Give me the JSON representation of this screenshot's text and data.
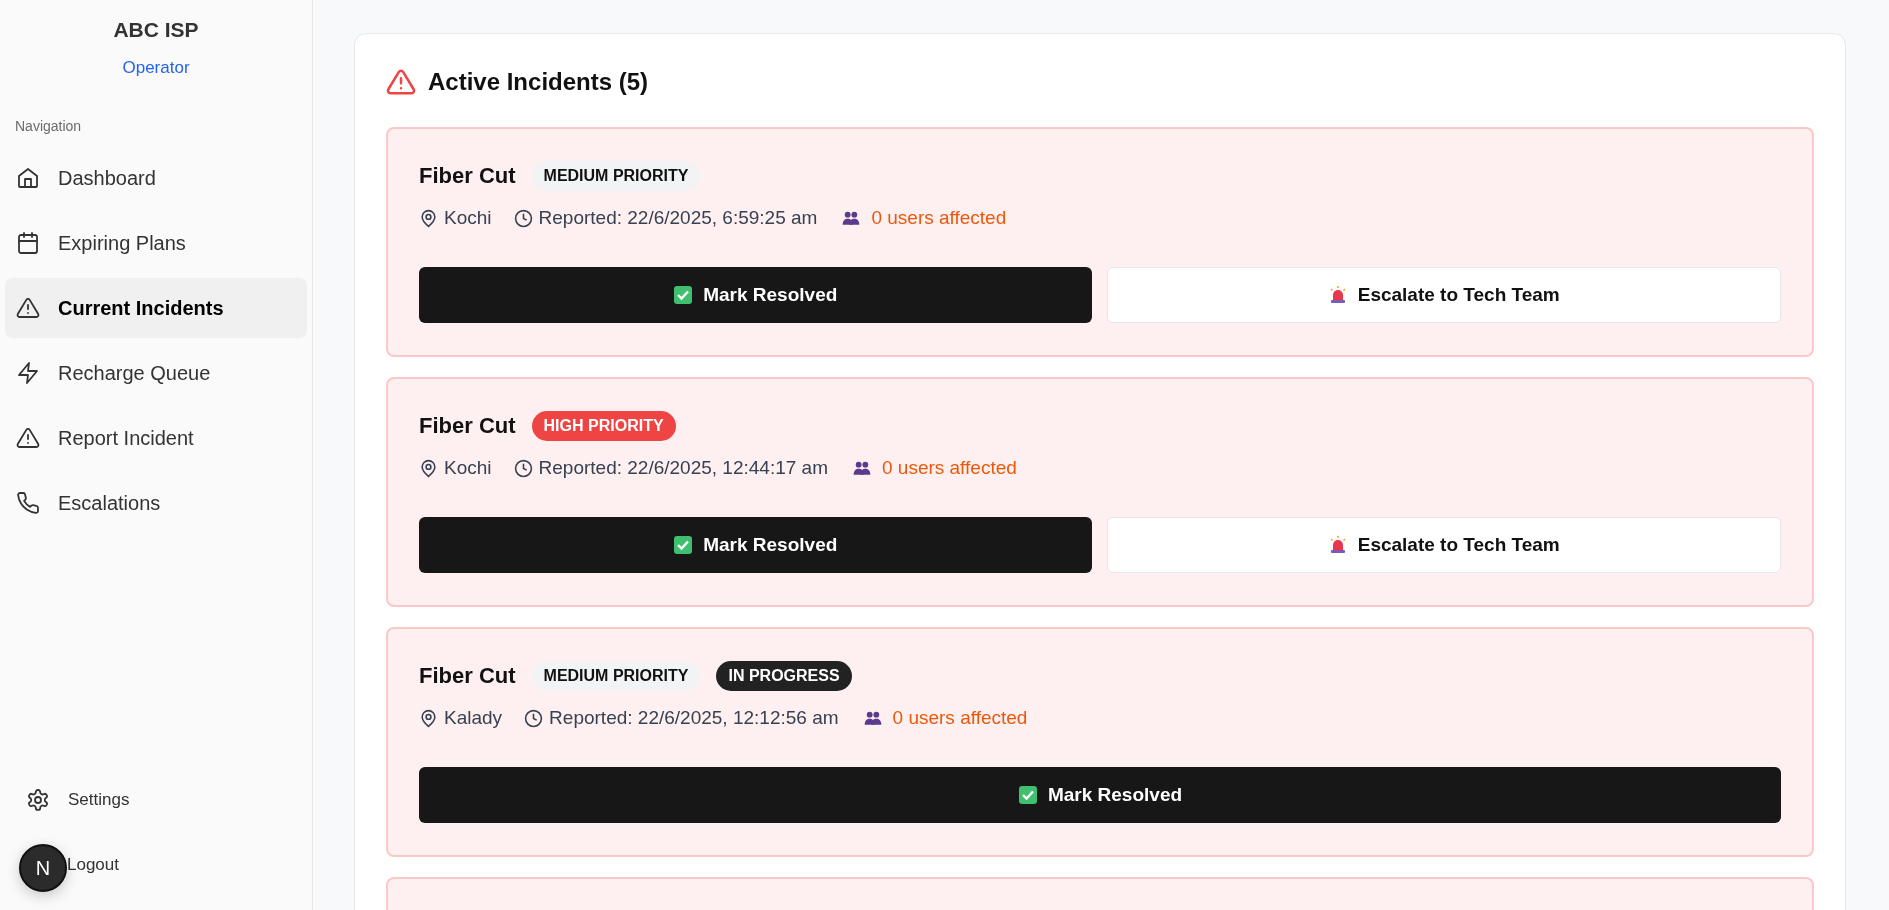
{
  "sidebar": {
    "brand": "ABC ISP",
    "role": "Operator",
    "section_label": "Navigation",
    "items": [
      {
        "label": "Dashboard",
        "kind": "home",
        "selected": false
      },
      {
        "label": "Expiring Plans",
        "kind": "calendar",
        "selected": false
      },
      {
        "label": "Current Incidents",
        "kind": "warning",
        "selected": true
      },
      {
        "label": "Recharge Queue",
        "kind": "bolt",
        "selected": false
      },
      {
        "label": "Report Incident",
        "kind": "warning",
        "selected": false
      },
      {
        "label": "Escalations",
        "kind": "phone",
        "selected": false
      }
    ],
    "footer_items": [
      {
        "label": "Settings",
        "kind": "settings"
      },
      {
        "label": "Logout",
        "kind": "logout"
      }
    ],
    "dev_badge": "N"
  },
  "panel": {
    "title": "Active Incidents (5)",
    "incidents": [
      {
        "title": "Fiber Cut",
        "priority": {
          "label": "MEDIUM PRIORITY",
          "kind": "medium"
        },
        "location": "Kochi",
        "reported": "Reported: 22/6/2025, 6:59:25 am",
        "affected": "0 users affected",
        "buttons": [
          {
            "label": "Mark Resolved",
            "kind": "resolve"
          },
          {
            "label": "Escalate to Tech Team",
            "kind": "escalate"
          }
        ]
      },
      {
        "title": "Fiber Cut",
        "priority": {
          "label": "HIGH PRIORITY",
          "kind": "high"
        },
        "location": "Kochi",
        "reported": "Reported: 22/6/2025, 12:44:17 am",
        "affected": "0 users affected",
        "buttons": [
          {
            "label": "Mark Resolved",
            "kind": "resolve"
          },
          {
            "label": "Escalate to Tech Team",
            "kind": "escalate"
          }
        ]
      },
      {
        "title": "Fiber Cut",
        "priority": {
          "label": "MEDIUM PRIORITY",
          "kind": "medium"
        },
        "status": "IN PROGRESS",
        "location": "Kalady",
        "reported": "Reported: 22/6/2025, 12:12:56 am",
        "affected": "0 users affected",
        "buttons": [
          {
            "label": "Mark Resolved",
            "kind": "resolve"
          }
        ]
      }
    ],
    "clipped_card_below": true
  }
}
